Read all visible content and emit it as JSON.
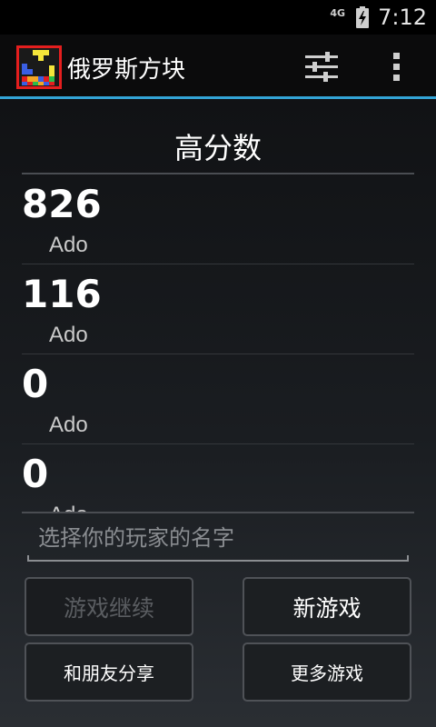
{
  "status_bar": {
    "network": "4G",
    "time": "7:12",
    "icons": [
      "battery-charging-icon"
    ]
  },
  "action_bar": {
    "title": "俄罗斯方块",
    "icons": [
      "app-logo",
      "settings-sliders-icon",
      "overflow-menu-icon"
    ]
  },
  "highscores": {
    "title": "高分数",
    "entries": [
      {
        "score": "826",
        "player": "Ado"
      },
      {
        "score": "116",
        "player": "Ado"
      },
      {
        "score": "0",
        "player": "Ado"
      },
      {
        "score": "0",
        "player": "Ado"
      }
    ]
  },
  "name_input": {
    "placeholder": "选择你的玩家的名字",
    "value": ""
  },
  "buttons": {
    "continue_label": "游戏继续",
    "continue_enabled": false,
    "new_game_label": "新游戏",
    "share_label": "和朋友分享",
    "more_games_label": "更多游戏"
  },
  "colors": {
    "accent": "#33a4d6",
    "background": "#1a1d21",
    "disabled_text": "#5a5d61"
  }
}
